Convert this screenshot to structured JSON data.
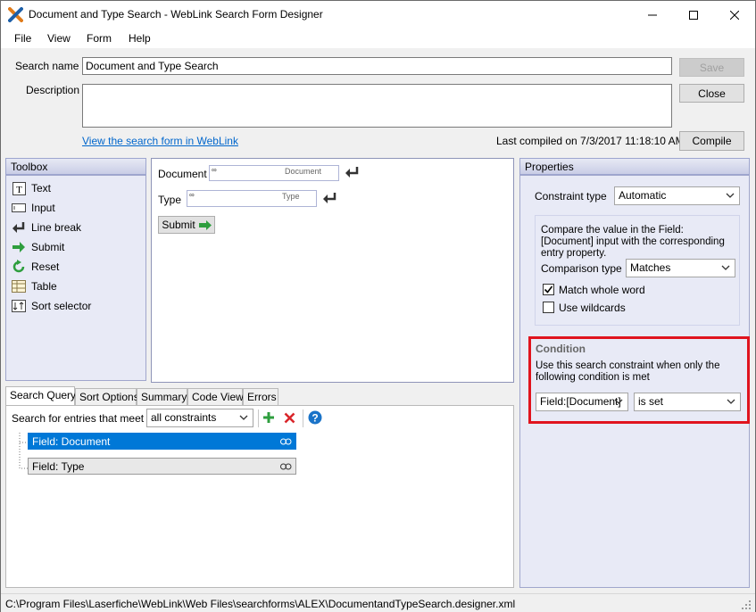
{
  "window": {
    "title": "Document and Type Search - WebLink Search Form Designer"
  },
  "menu": [
    "File",
    "View",
    "Form",
    "Help"
  ],
  "form": {
    "search_name_label": "Search name",
    "search_name_value": "Document and Type Search",
    "description_label": "Description",
    "description_value": "",
    "save_label": "Save",
    "close_label": "Close",
    "view_link": "View the search form in WebLink",
    "last_compiled": "Last compiled on 7/3/2017 11:18:10 AM",
    "compile_label": "Compile"
  },
  "toolbox": {
    "header": "Toolbox",
    "items": [
      {
        "label": "Text",
        "icon": "text-icon"
      },
      {
        "label": "Input",
        "icon": "input-icon"
      },
      {
        "label": "Line break",
        "icon": "line-break-icon"
      },
      {
        "label": "Submit",
        "icon": "submit-arrow-icon"
      },
      {
        "label": "Reset",
        "icon": "reset-icon"
      },
      {
        "label": "Table",
        "icon": "table-icon"
      },
      {
        "label": "Sort selector",
        "icon": "sort-selector-icon"
      }
    ]
  },
  "designer": {
    "document_label": "Document",
    "document_field": "Document",
    "type_label": "Type",
    "type_field": "Type",
    "submit_label": "Submit"
  },
  "query": {
    "tabs": [
      "Search Query",
      "Sort Options",
      "Summary",
      "Code View",
      "Errors"
    ],
    "active_tab": "Search Query",
    "meet_label": "Search for entries that meet",
    "meet_value": "all constraints",
    "tree": [
      "Field: Document",
      "Field: Type"
    ],
    "selected": "Field: Document"
  },
  "properties": {
    "header": "Properties",
    "constraint_type_label": "Constraint type",
    "constraint_type_value": "Automatic",
    "compare_text": "Compare the value in the Field:[Document] input with the corresponding entry property.",
    "comparison_type_label": "Comparison type",
    "comparison_type_value": "Matches",
    "match_whole_word": "Match whole word",
    "match_whole_word_checked": true,
    "use_wildcards": "Use wildcards",
    "use_wildcards_checked": false,
    "condition_title": "Condition",
    "condition_text": "Use this search constraint when only the following condition is met",
    "condition_field": "Field:[Document]",
    "condition_op": "is set"
  },
  "status": {
    "path": "C:\\Program Files\\Laserfiche\\WebLink\\Web Files\\searchforms\\ALEX\\DocumentandTypeSearch.designer.xml"
  },
  "colors": {
    "accent": "#0078d7",
    "highlight_red": "#e0141e",
    "link": "#0066cc",
    "add_green": "#2e9e3e",
    "delete_red": "#d9262b",
    "help_blue": "#1a73c8"
  }
}
